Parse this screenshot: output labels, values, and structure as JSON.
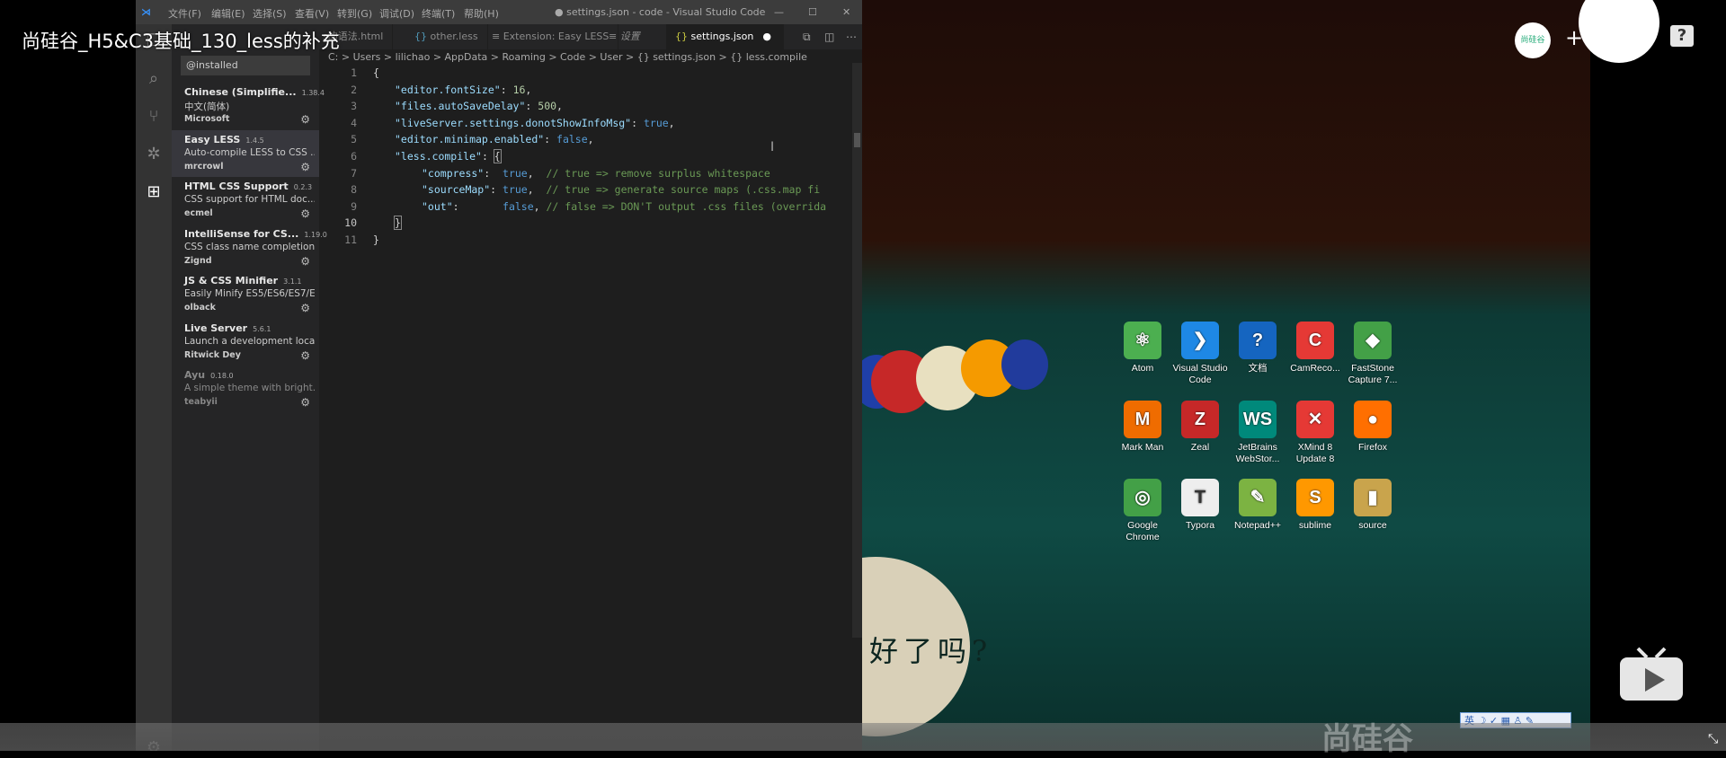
{
  "video": {
    "title": "尚硅谷_H5&C3基础_130_less的补充"
  },
  "vscode": {
    "menu": [
      "文件(F)",
      "编辑(E)",
      "选择(S)",
      "查看(V)",
      "转到(G)",
      "调试(D)",
      "终端(T)",
      "帮助(H)"
    ],
    "window_title": "● settings.json - code - Visual Studio Code",
    "extensions_search": "@installed",
    "extensions": [
      {
        "name": "Chinese (Simplifie...",
        "version": "1.38.4",
        "desc": "中文(简体)",
        "publisher": "Microsoft"
      },
      {
        "name": "Easy LESS",
        "version": "1.4.5",
        "desc": "Auto-compile LESS to CSS ...",
        "publisher": "mrcrowl"
      },
      {
        "name": "HTML CSS Support",
        "version": "0.2.3",
        "desc": "CSS support for HTML doc...",
        "publisher": "ecmel"
      },
      {
        "name": "IntelliSense for CS...",
        "version": "1.19.0",
        "desc": "CSS class name completion...",
        "publisher": "Zignd"
      },
      {
        "name": "JS & CSS Minifier",
        "version": "3.1.1",
        "desc": "Easily Minify ES5/ES6/ES7/E...",
        "publisher": "olback"
      },
      {
        "name": "Live Server",
        "version": "5.6.1",
        "desc": "Launch a development loca...",
        "publisher": "Ritwick Dey"
      },
      {
        "name": "Ayu",
        "version": "0.18.0",
        "desc": "A simple theme with bright...",
        "publisher": "teabyii"
      }
    ],
    "tabs": [
      "s的语法.html",
      "other.less",
      "Extension: Easy LESS",
      "设置",
      "settings.json"
    ],
    "breadcrumb": "C: > Users > lilichao > AppData > Roaming > Code > User > {} settings.json > {} less.compile",
    "line_numbers": [
      "1",
      "2",
      "3",
      "4",
      "5",
      "6",
      "7",
      "8",
      "9",
      "10",
      "11"
    ],
    "code": {
      "l2_key": "\"editor.fontSize\"",
      "l2_val": "16",
      "l3_key": "\"files.autoSaveDelay\"",
      "l3_val": "500",
      "l4_key": "\"liveServer.settings.donotShowInfoMsg\"",
      "l4_val": "true",
      "l5_key": "\"editor.minimap.enabled\"",
      "l5_val": "false",
      "l6_key": "\"less.compile\"",
      "l7_key": "\"compress\"",
      "l7_val": "true",
      "l7_comment": "// true => remove surplus whitespace",
      "l8_key": "\"sourceMap\"",
      "l8_val": "true",
      "l8_comment": "// true => generate source maps (.css.map fi",
      "l9_key": "\"out\"",
      "l9_val": "false",
      "l9_comment": "// false => DON'T output .css files (overrida"
    }
  },
  "desktop": {
    "icons": [
      {
        "label": "Atom",
        "color": "#4caf50",
        "glyph": "⚛"
      },
      {
        "label": "Visual Studio Code",
        "color": "#1e88e5",
        "glyph": "❯"
      },
      {
        "label": "文档",
        "color": "#1565c0",
        "glyph": "?"
      },
      {
        "label": "CamReco...",
        "color": "#e53935",
        "glyph": "C"
      },
      {
        "label": "FastStone Capture 7...",
        "color": "#43a047",
        "glyph": "◆"
      },
      {
        "label": "Mark Man",
        "color": "#ef6c00",
        "glyph": "M"
      },
      {
        "label": "Zeal",
        "color": "#c62828",
        "glyph": "Z"
      },
      {
        "label": "JetBrains WebStor...",
        "color": "#00897b",
        "glyph": "WS"
      },
      {
        "label": "XMind 8 Update 8",
        "color": "#e53935",
        "glyph": "✕"
      },
      {
        "label": "Firefox",
        "color": "#ff6f00",
        "glyph": "●"
      },
      {
        "label": "Google Chrome",
        "color": "#43a047",
        "glyph": "◎"
      },
      {
        "label": "Typora",
        "color": "#eeeeee",
        "glyph": "T"
      },
      {
        "label": "Notepad++",
        "color": "#7cb342",
        "glyph": "✎"
      },
      {
        "label": "sublime",
        "color": "#ff9800",
        "glyph": "S"
      },
      {
        "label": "source",
        "color": "#c9a44c",
        "glyph": "▮"
      }
    ],
    "ime": "英 ☽ ✓ ▦ ♙ ✎",
    "wall_text": "好了吗?",
    "brand": "尚硅谷"
  },
  "player": {
    "help": "?",
    "plus": "+",
    "avatar": "尚硅谷"
  }
}
